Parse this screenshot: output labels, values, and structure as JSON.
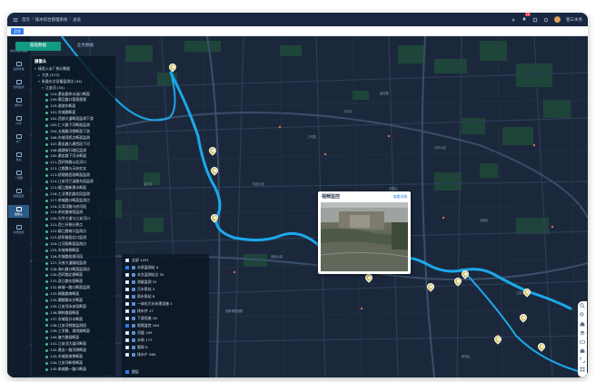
{
  "topbar": {
    "home_label": "首页",
    "crumb_1": "排水综合管理系统",
    "crumb_2": "总览",
    "notification_count": "12",
    "user_name": "管三水务"
  },
  "tabstrip": {
    "active_tab": "总览"
  },
  "panel_tabs": [
    "基础数据",
    "业务数据"
  ],
  "sidebar": {
    "items": [
      {
        "label": "排水管网\n数据"
      },
      {
        "label": "设施管理"
      },
      {
        "label": "管网监测"
      },
      {
        "label": "排水户"
      },
      {
        "label": "内涝"
      },
      {
        "label": "水厂"
      },
      {
        "label": "泵站"
      },
      {
        "label": "一张图"
      },
      {
        "label": "视频监控"
      },
      {
        "label": "摄像头"
      },
      {
        "label": "水质监测"
      }
    ]
  },
  "tree": {
    "title": "摄像头",
    "rows": [
      {
        "indent": 0,
        "caret": "▾",
        "text": "接驳入水厂统计数据"
      },
      {
        "indent": 1,
        "caret": "▸",
        "text": "大良 (573)"
      },
      {
        "indent": 1,
        "caret": "▾",
        "text": "街道水文设备监测点 (44)"
      },
      {
        "indent": 2,
        "caret": "▾",
        "text": "江安河 (34)"
      },
      {
        "indent": 3,
        "text": "110-黄忠路杀水涵口断面"
      },
      {
        "indent": 3,
        "text": "109-蜀汉路口管理视频"
      },
      {
        "indent": 3,
        "text": "129-湖滨东断面"
      },
      {
        "indent": 3,
        "text": "101-东城路断面"
      },
      {
        "indent": 3,
        "text": "102-西部大道断面监测下游"
      },
      {
        "indent": 3,
        "text": "103-仁义路下河断面监测"
      },
      {
        "indent": 3,
        "text": "104-五福路河侧断面下游"
      },
      {
        "indent": 3,
        "text": "108-东城湾桥点断面监测"
      },
      {
        "indent": 3,
        "text": "107-黄忠路九建西段下河"
      },
      {
        "indent": 3,
        "text": "106-顺建街行政区监测"
      },
      {
        "indent": 3,
        "text": "105-黄忠路下河水断面"
      },
      {
        "indent": 3,
        "text": "111-西环铁路以北河口"
      },
      {
        "indent": 3,
        "text": "112-江都路与天府交叉"
      },
      {
        "indent": 3,
        "text": "113-桥建路西段断面监测"
      },
      {
        "indent": 3,
        "text": "114-江安河兰溪路东段监测"
      },
      {
        "indent": 3,
        "text": "115-顺江路新建水断面"
      },
      {
        "indent": 3,
        "text": "116-工业港北路北段监测"
      },
      {
        "indent": 3,
        "text": "117-府城路口断面监测点"
      },
      {
        "indent": 3,
        "text": "118-天湾河路与府河段"
      },
      {
        "indent": 3,
        "text": "119-茶花路南段监测"
      },
      {
        "indent": 3,
        "text": "120-光华大道与江安河口"
      },
      {
        "indent": 3,
        "text": "121-西三环侧分界点"
      },
      {
        "indent": 3,
        "text": "122-顺江路南口监测点"
      },
      {
        "indent": 3,
        "text": "123-桥亭路段北口监测"
      },
      {
        "indent": 3,
        "text": "124-江河段断面监测点"
      },
      {
        "indent": 3,
        "text": "125-东城南侧断面"
      },
      {
        "indent": 3,
        "text": "126-东城路检测河段"
      },
      {
        "indent": 3,
        "text": "127-天府大道路段监测"
      },
      {
        "indent": 3,
        "text": "128-海川路口断面监测点"
      },
      {
        "indent": 3,
        "text": "130-西环路北侧断面"
      },
      {
        "indent": 3,
        "text": "131-双江路东段断面"
      },
      {
        "indent": 3,
        "text": "132-新城一路口断面监测"
      },
      {
        "indent": 3,
        "text": "133-桐路路南断面"
      },
      {
        "indent": 3,
        "text": "134-蜀都路水文断面"
      },
      {
        "indent": 3,
        "text": "135-江安河永安段断面"
      },
      {
        "indent": 3,
        "text": "136-桐梓路段断面"
      },
      {
        "indent": 3,
        "text": "137-东城段分水断面"
      },
      {
        "indent": 3,
        "text": "138-江安河铁路监测段"
      },
      {
        "indent": 3,
        "text": "139-工学路、湖滨路断面"
      },
      {
        "indent": 3,
        "text": "140-复兴路段断面"
      },
      {
        "indent": 3,
        "text": "141-江安河大渡河断面"
      },
      {
        "indent": 3,
        "text": "142-黄忠一路河侧断面"
      },
      {
        "indent": 3,
        "text": "143-东城段南侧断面"
      },
      {
        "indent": 3,
        "text": "144-江安河新桥断面"
      },
      {
        "indent": 3,
        "text": "145-南湖路一路口断面"
      }
    ]
  },
  "legend": {
    "rows": [
      {
        "checked": false,
        "text": "全部  1431"
      },
      {
        "checked": true,
        "text": "水质监测站  4"
      },
      {
        "checked": false,
        "text": "水文监测站点  32"
      },
      {
        "checked": false,
        "text": "流量监测  31"
      },
      {
        "checked": false,
        "text": "污水泵站  3"
      },
      {
        "checked": false,
        "text": "雨水泵站  8"
      },
      {
        "checked": false,
        "text": "一体化污水处理设施  2"
      },
      {
        "checked": false,
        "text": "排水井  17"
      },
      {
        "checked": false,
        "text": "下游设施  16"
      },
      {
        "checked": true,
        "text": "视频监控  184"
      },
      {
        "checked": false,
        "text": "河道  109"
      },
      {
        "checked": false,
        "text": "水闸  177"
      },
      {
        "checked": false,
        "text": "管网  9"
      },
      {
        "checked": false,
        "text": "排水户  369"
      }
    ],
    "footer_label": "图层"
  },
  "popup": {
    "title": "视频监控",
    "more_link": "查看详情"
  },
  "zoombar": {
    "buttons": [
      "zoom-in",
      "zoom-out",
      "home",
      "layers",
      "measure",
      "print"
    ]
  },
  "map_labels": [
    "三环路",
    "建设路",
    "江安河",
    "双流区",
    "温江区",
    "凤凰大道",
    "成新蒲快速路",
    "西部大道",
    "光华大道",
    "青羊区",
    "高新区",
    "武侯区"
  ]
}
